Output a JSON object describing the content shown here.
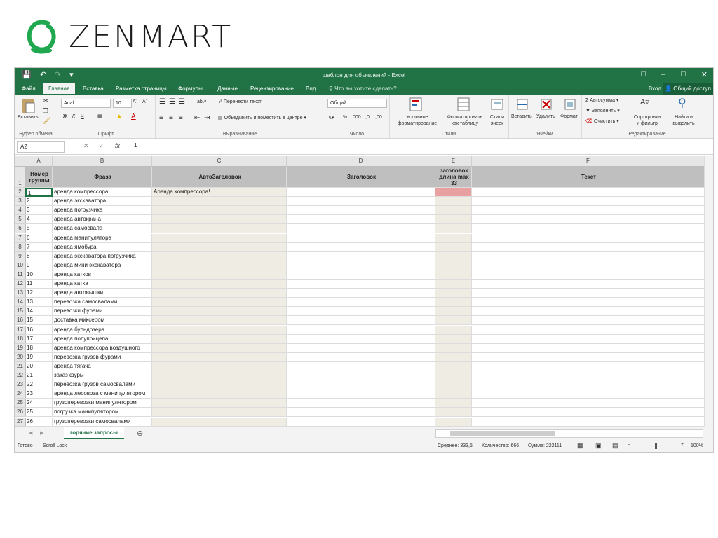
{
  "brand": {
    "name": "ZENMART",
    "color": "#1fa84f"
  },
  "excel": {
    "title": "шаблон для объявлений - Excel",
    "accent": "#217346",
    "tabs": [
      "Файл",
      "Главная",
      "Вставка",
      "Разметка страницы",
      "Формулы",
      "Данные",
      "Рецензирование",
      "Вид"
    ],
    "tell_me": "Что вы хотите сделать?",
    "sign_in": "Вход",
    "share": "Общий доступ",
    "ribbon": {
      "clipboard": {
        "paste": "Вставить",
        "label": "Буфер обмена"
      },
      "font": {
        "name": "Arial",
        "size": "10",
        "bold": "Ж",
        "italic": "К",
        "underline": "Ч",
        "label": "Шрифт"
      },
      "alignment": {
        "wrap": "Перенести текст",
        "merge": "Объединить и поместить в центре",
        "label": "Выравнивание"
      },
      "number": {
        "format": "Общий",
        "percent": "%",
        "thousands": "000",
        "label": "Число"
      },
      "styles": {
        "conditional": "Условное форматирование",
        "format_table": "Форматировать как таблицу",
        "cell_styles": "Стили ячеек",
        "label": "Стили"
      },
      "cells": {
        "insert": "Вставить",
        "delete": "Удалить",
        "format": "Формат",
        "label": "Ячейки"
      },
      "editing": {
        "autosum": "Автосумма",
        "fill": "Заполнить",
        "clear": "Очистить",
        "sort": "Сортировка и фильтр",
        "find": "Найти и выделить",
        "label": "Редактирование"
      }
    },
    "formula_bar": {
      "name_box": "A2",
      "fx": "fx",
      "value": "1"
    },
    "columns": [
      "A",
      "B",
      "C",
      "D",
      "E",
      "F"
    ],
    "headers": [
      "Номер группы",
      "Фраза",
      "АвтоЗаголовок",
      "Заголовок",
      "заголовок длина max 33",
      "Текст"
    ],
    "rows": [
      {
        "n": "2",
        "a": "1",
        "b": "аренда компрессора",
        "c": "Аренда компрессора!"
      },
      {
        "n": "3",
        "a": "2",
        "b": "аренда экскаватора",
        "c": ""
      },
      {
        "n": "4",
        "a": "3",
        "b": "аренда погрузчика",
        "c": ""
      },
      {
        "n": "5",
        "a": "4",
        "b": "аренда автокрана",
        "c": ""
      },
      {
        "n": "6",
        "a": "5",
        "b": "аренда самосвала",
        "c": ""
      },
      {
        "n": "7",
        "a": "6",
        "b": "аренда манипулятора",
        "c": ""
      },
      {
        "n": "8",
        "a": "7",
        "b": "аренда ямобура",
        "c": ""
      },
      {
        "n": "9",
        "a": "8",
        "b": "аренда экскаватора погрузчика",
        "c": ""
      },
      {
        "n": "10",
        "a": "9",
        "b": "аренда мини экскаватора",
        "c": ""
      },
      {
        "n": "11",
        "a": "10",
        "b": "аренда катков",
        "c": ""
      },
      {
        "n": "12",
        "a": "11",
        "b": "аренда катка",
        "c": ""
      },
      {
        "n": "13",
        "a": "12",
        "b": "аренда автовышки",
        "c": ""
      },
      {
        "n": "14",
        "a": "13",
        "b": "перевозка самосвалами",
        "c": ""
      },
      {
        "n": "15",
        "a": "14",
        "b": "перевозки фурами",
        "c": ""
      },
      {
        "n": "16",
        "a": "15",
        "b": "доставка миксером",
        "c": ""
      },
      {
        "n": "17",
        "a": "16",
        "b": "аренда бульдозера",
        "c": ""
      },
      {
        "n": "18",
        "a": "17",
        "b": "аренда полуприцепа",
        "c": ""
      },
      {
        "n": "19",
        "a": "18",
        "b": "аренда компрессора воздушного",
        "c": ""
      },
      {
        "n": "20",
        "a": "19",
        "b": "перевозка грузов фурами",
        "c": ""
      },
      {
        "n": "21",
        "a": "20",
        "b": "аренда тягача",
        "c": ""
      },
      {
        "n": "22",
        "a": "21",
        "b": "заказ фуры",
        "c": ""
      },
      {
        "n": "23",
        "a": "22",
        "b": "перевозка грузов самосвалами",
        "c": ""
      },
      {
        "n": "24",
        "a": "23",
        "b": "аренда лесовоза с манипулятором",
        "c": ""
      },
      {
        "n": "25",
        "a": "24",
        "b": "грузоперевозки манипулятором",
        "c": ""
      },
      {
        "n": "26",
        "a": "25",
        "b": "погрузка манипулятором",
        "c": ""
      },
      {
        "n": "27",
        "a": "26",
        "b": "грузоперевозки самосвалами",
        "c": ""
      }
    ],
    "sheet_tab": "горячие запросы",
    "status": {
      "ready": "Готово",
      "scroll_lock": "Scroll Lock",
      "average": "Среднее: 333,5",
      "count": "Количество: 666",
      "sum": "Сумма: 222111",
      "zoom": "100%"
    }
  }
}
